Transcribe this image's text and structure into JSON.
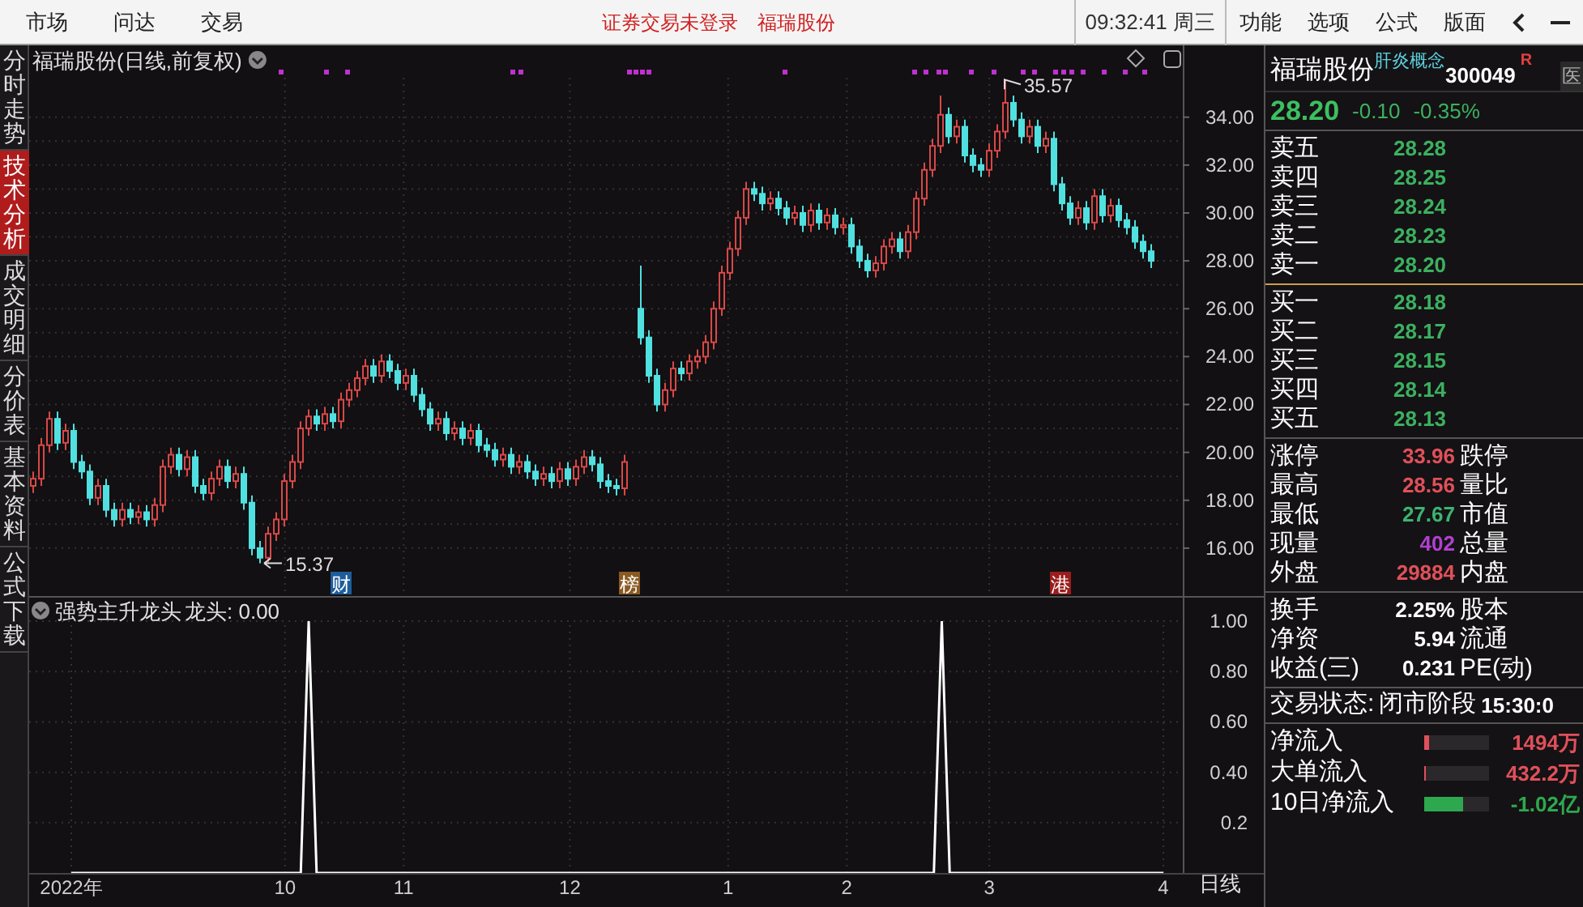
{
  "menu_bar": {
    "left_items": [
      "市场",
      "问达",
      "交易"
    ],
    "notice": "证券交易未登录",
    "stock": "福瑞股份",
    "clock": "09:32:41 周三",
    "right_items": [
      "功能",
      "选项",
      "公式",
      "版面"
    ]
  },
  "side_tabs": [
    {
      "label": "分时走势",
      "selected": false
    },
    {
      "label": "技术分析",
      "selected": true
    },
    {
      "label": "成交明细",
      "selected": false
    },
    {
      "label": "分价表",
      "selected": false
    },
    {
      "label": "基本资料",
      "selected": false
    },
    {
      "label": "公式下载",
      "selected": false
    }
  ],
  "main_chart": {
    "title": "福瑞股份(日线,前复权)",
    "high_label": "35.57",
    "low_label": "15.37",
    "event_marks": [
      {
        "label": "财",
        "color": "#1d5d9b"
      },
      {
        "label": "榜",
        "color": "#8a5a22"
      },
      {
        "label": "港",
        "color": "#9b1d1d"
      }
    ],
    "chart_data": {
      "type": "candlestick",
      "grid": true,
      "ylim": [
        14,
        37
      ],
      "yticks": [
        {
          "value": 34,
          "label": "34.00"
        },
        {
          "value": 32,
          "label": "32.00"
        },
        {
          "value": 30,
          "label": "30.00"
        },
        {
          "value": 28,
          "label": "28.00"
        },
        {
          "value": 26,
          "label": "26.00"
        },
        {
          "value": 24,
          "label": "24.00"
        },
        {
          "value": 22,
          "label": "22.00"
        },
        {
          "value": 20,
          "label": "20.00"
        },
        {
          "value": 18,
          "label": "18.00"
        },
        {
          "value": 16,
          "label": "16.00"
        }
      ],
      "ohlc": [
        [
          18.6,
          19.2,
          18.3,
          18.9
        ],
        [
          18.9,
          20.6,
          18.6,
          20.3
        ],
        [
          20.3,
          21.7,
          20.0,
          21.4
        ],
        [
          21.4,
          21.7,
          20.1,
          20.4
        ],
        [
          20.4,
          21.2,
          20.1,
          20.9
        ],
        [
          20.9,
          21.2,
          19.3,
          19.6
        ],
        [
          19.6,
          19.9,
          18.9,
          19.2
        ],
        [
          19.2,
          19.5,
          17.8,
          18.1
        ],
        [
          18.1,
          18.9,
          17.8,
          18.6
        ],
        [
          18.6,
          18.9,
          17.3,
          17.6
        ],
        [
          17.6,
          17.9,
          16.9,
          17.2
        ],
        [
          17.2,
          17.9,
          16.9,
          17.6
        ],
        [
          17.6,
          17.9,
          17.0,
          17.3
        ],
        [
          17.3,
          17.8,
          17.0,
          17.5
        ],
        [
          17.5,
          17.8,
          16.9,
          17.2
        ],
        [
          17.2,
          18.1,
          16.9,
          17.8
        ],
        [
          17.8,
          19.7,
          17.5,
          19.4
        ],
        [
          19.4,
          20.2,
          19.1,
          19.9
        ],
        [
          19.9,
          20.2,
          19.0,
          19.3
        ],
        [
          19.3,
          20.1,
          19.0,
          19.8
        ],
        [
          19.8,
          20.1,
          18.3,
          18.6
        ],
        [
          18.6,
          18.9,
          18.0,
          18.3
        ],
        [
          18.3,
          19.2,
          18.0,
          18.9
        ],
        [
          18.9,
          19.7,
          18.6,
          19.4
        ],
        [
          19.4,
          19.7,
          18.5,
          18.8
        ],
        [
          18.8,
          19.4,
          18.5,
          19.1
        ],
        [
          19.1,
          19.4,
          17.6,
          17.9
        ],
        [
          17.9,
          18.2,
          15.7,
          16.0
        ],
        [
          16.0,
          16.3,
          15.37,
          15.6
        ],
        [
          15.6,
          16.9,
          15.4,
          16.6
        ],
        [
          16.6,
          17.5,
          16.3,
          17.2
        ],
        [
          17.2,
          19.1,
          16.9,
          18.8
        ],
        [
          18.8,
          19.9,
          18.5,
          19.6
        ],
        [
          19.6,
          21.3,
          19.3,
          21.0
        ],
        [
          21.0,
          21.8,
          20.7,
          21.5
        ],
        [
          21.5,
          21.8,
          20.9,
          21.2
        ],
        [
          21.2,
          21.9,
          20.9,
          21.6
        ],
        [
          21.6,
          21.9,
          21.0,
          21.3
        ],
        [
          21.3,
          22.5,
          21.0,
          22.2
        ],
        [
          22.2,
          22.9,
          21.9,
          22.6
        ],
        [
          22.6,
          23.4,
          22.3,
          23.1
        ],
        [
          23.1,
          23.9,
          22.8,
          23.6
        ],
        [
          23.6,
          23.9,
          22.9,
          23.2
        ],
        [
          23.2,
          24.1,
          22.9,
          23.8
        ],
        [
          23.8,
          24.1,
          23.1,
          23.4
        ],
        [
          23.4,
          23.7,
          22.6,
          22.9
        ],
        [
          22.9,
          23.5,
          22.6,
          23.2
        ],
        [
          23.2,
          23.5,
          22.1,
          22.4
        ],
        [
          22.4,
          22.7,
          21.5,
          21.8
        ],
        [
          21.8,
          22.1,
          20.9,
          21.2
        ],
        [
          21.2,
          21.7,
          20.9,
          21.4
        ],
        [
          21.4,
          21.7,
          20.5,
          20.8
        ],
        [
          20.8,
          21.3,
          20.5,
          21.0
        ],
        [
          21.0,
          21.3,
          20.3,
          20.6
        ],
        [
          20.6,
          21.2,
          20.3,
          20.9
        ],
        [
          20.9,
          21.2,
          20.0,
          20.3
        ],
        [
          20.3,
          20.6,
          19.8,
          20.1
        ],
        [
          20.1,
          20.4,
          19.4,
          19.7
        ],
        [
          19.7,
          20.2,
          19.4,
          19.9
        ],
        [
          19.9,
          20.2,
          19.1,
          19.4
        ],
        [
          19.4,
          19.9,
          19.1,
          19.6
        ],
        [
          19.6,
          19.9,
          18.9,
          19.2
        ],
        [
          19.2,
          19.5,
          18.6,
          18.9
        ],
        [
          18.9,
          19.4,
          18.6,
          19.1
        ],
        [
          19.1,
          19.4,
          18.5,
          18.8
        ],
        [
          18.8,
          19.6,
          18.5,
          19.3
        ],
        [
          19.3,
          19.6,
          18.6,
          18.9
        ],
        [
          18.9,
          19.7,
          18.6,
          19.4
        ],
        [
          19.4,
          20.1,
          19.1,
          19.8
        ],
        [
          19.8,
          20.1,
          19.2,
          19.5
        ],
        [
          19.5,
          19.8,
          18.5,
          18.8
        ],
        [
          18.8,
          19.1,
          18.3,
          18.6
        ],
        [
          18.6,
          18.9,
          18.2,
          18.5
        ],
        [
          18.5,
          19.9,
          18.2,
          19.6
        ],
        null,
        [
          26.0,
          27.8,
          24.5,
          24.8
        ],
        [
          24.8,
          25.1,
          22.9,
          23.2
        ],
        [
          23.2,
          23.5,
          21.7,
          22.0
        ],
        [
          22.0,
          22.9,
          21.7,
          22.6
        ],
        [
          22.6,
          23.8,
          22.3,
          23.5
        ],
        [
          23.5,
          23.8,
          23.0,
          23.3
        ],
        [
          23.3,
          24.1,
          23.0,
          23.8
        ],
        [
          23.8,
          24.3,
          23.5,
          24.0
        ],
        [
          24.0,
          24.9,
          23.7,
          24.6
        ],
        [
          24.6,
          26.3,
          24.3,
          26.0
        ],
        [
          26.0,
          27.8,
          25.7,
          27.5
        ],
        [
          27.5,
          28.8,
          27.2,
          28.5
        ],
        [
          28.5,
          30.1,
          28.2,
          29.8
        ],
        [
          29.8,
          31.3,
          29.5,
          31.0
        ],
        [
          31.0,
          31.3,
          30.5,
          30.8
        ],
        [
          30.8,
          31.1,
          30.1,
          30.4
        ],
        [
          30.4,
          30.9,
          30.1,
          30.6
        ],
        [
          30.6,
          30.9,
          29.9,
          30.2
        ],
        [
          30.2,
          30.5,
          29.5,
          29.8
        ],
        [
          29.8,
          30.3,
          29.5,
          30.0
        ],
        [
          30.0,
          30.3,
          29.2,
          29.5
        ],
        [
          29.5,
          30.4,
          29.2,
          30.1
        ],
        [
          30.1,
          30.4,
          29.3,
          29.6
        ],
        [
          29.6,
          30.2,
          29.3,
          29.9
        ],
        [
          29.9,
          30.2,
          29.1,
          29.4
        ],
        [
          29.4,
          29.8,
          29.1,
          29.5
        ],
        [
          29.5,
          29.8,
          28.3,
          28.6
        ],
        [
          28.6,
          28.9,
          27.7,
          28.0
        ],
        [
          28.0,
          28.3,
          27.3,
          27.6
        ],
        [
          27.6,
          28.2,
          27.3,
          27.9
        ],
        [
          27.9,
          28.9,
          27.6,
          28.6
        ],
        [
          28.6,
          29.2,
          28.3,
          28.9
        ],
        [
          28.9,
          29.2,
          28.1,
          28.4
        ],
        [
          28.4,
          29.5,
          28.1,
          29.2
        ],
        [
          29.2,
          30.9,
          28.9,
          30.6
        ],
        [
          30.6,
          32.1,
          30.3,
          31.8
        ],
        [
          31.8,
          33.1,
          31.5,
          32.8
        ],
        [
          32.8,
          34.9,
          32.5,
          34.1
        ],
        [
          34.1,
          34.4,
          32.9,
          33.2
        ],
        [
          33.2,
          33.9,
          32.9,
          33.6
        ],
        [
          33.6,
          33.9,
          32.1,
          32.4
        ],
        [
          32.4,
          32.7,
          31.7,
          32.0
        ],
        [
          32.0,
          32.3,
          31.5,
          31.8
        ],
        [
          31.8,
          32.9,
          31.5,
          32.6
        ],
        [
          32.6,
          33.7,
          32.3,
          33.4
        ],
        [
          33.4,
          35.57,
          33.1,
          34.6
        ],
        [
          34.6,
          34.9,
          33.6,
          33.9
        ],
        [
          33.9,
          34.2,
          32.9,
          33.2
        ],
        [
          33.2,
          33.9,
          32.9,
          33.6
        ],
        [
          33.6,
          33.9,
          32.5,
          32.8
        ],
        [
          32.8,
          33.4,
          32.5,
          33.1
        ],
        [
          33.1,
          33.4,
          30.9,
          31.2
        ],
        [
          31.2,
          31.5,
          30.1,
          30.4
        ],
        [
          30.4,
          30.7,
          29.5,
          29.8
        ],
        [
          29.8,
          30.5,
          29.5,
          30.2
        ],
        [
          30.2,
          30.5,
          29.3,
          29.6
        ],
        [
          29.6,
          31.0,
          29.3,
          30.7
        ],
        [
          30.7,
          31.0,
          29.6,
          29.9
        ],
        [
          29.9,
          30.6,
          29.6,
          30.3
        ],
        [
          30.3,
          30.6,
          29.4,
          29.7
        ],
        [
          29.7,
          30.0,
          29.1,
          29.4
        ],
        [
          29.4,
          29.7,
          28.5,
          28.8
        ],
        [
          28.8,
          29.1,
          28.1,
          28.4
        ],
        [
          28.4,
          28.7,
          27.7,
          28.0
        ]
      ]
    }
  },
  "indicator_pane": {
    "title": "强势主升龙头",
    "reading": "龙头: 0.00",
    "chart_data": {
      "type": "line",
      "grid": true,
      "ylim": [
        0,
        1.1
      ],
      "yticks": [
        {
          "value": 1,
          "label": "1.00"
        },
        {
          "value": 0.8,
          "label": "0.80"
        },
        {
          "value": 0.6,
          "label": "0.60"
        },
        {
          "value": 0.4,
          "label": "0.40"
        },
        {
          "value": 0.2,
          "label": "0.2"
        }
      ],
      "categories": [
        "2022年",
        null,
        null,
        null,
        null,
        null,
        null,
        null,
        null,
        null,
        null,
        null,
        null,
        null,
        null,
        null,
        null,
        null,
        null,
        null,
        null,
        null,
        null,
        null,
        null,
        null,
        null,
        "10",
        null,
        null,
        null,
        null,
        null,
        null,
        null,
        null,
        null,
        null,
        null,
        null,
        null,
        null,
        "11",
        null,
        null,
        null,
        null,
        null,
        null,
        null,
        null,
        null,
        null,
        null,
        null,
        null,
        null,
        null,
        null,
        null,
        null,
        null,
        null,
        "12",
        null,
        null,
        null,
        null,
        null,
        null,
        null,
        null,
        null,
        null,
        null,
        null,
        null,
        null,
        null,
        null,
        null,
        null,
        null,
        "1",
        null,
        null,
        null,
        null,
        null,
        null,
        null,
        null,
        null,
        null,
        null,
        null,
        null,
        null,
        "2",
        null,
        null,
        null,
        null,
        null,
        null,
        null,
        null,
        null,
        null,
        null,
        null,
        null,
        null,
        null,
        null,
        null,
        "3",
        null,
        null,
        null,
        null,
        null,
        null,
        null,
        null,
        null,
        null,
        null,
        null,
        null,
        null,
        null,
        null,
        null,
        null,
        null,
        null,
        null,
        "4"
      ],
      "series": [
        {
          "color": "#ffffff",
          "values": [
            0,
            0,
            0,
            0,
            0,
            0,
            0,
            0,
            0,
            0,
            0,
            0,
            0,
            0,
            0,
            0,
            0,
            0,
            0,
            0,
            0,
            0,
            0,
            0,
            0,
            0,
            0,
            0,
            0,
            0,
            1,
            0,
            0,
            0,
            0,
            0,
            0,
            0,
            0,
            0,
            0,
            0,
            0,
            0,
            0,
            0,
            0,
            0,
            0,
            0,
            0,
            0,
            0,
            0,
            0,
            0,
            0,
            0,
            0,
            0,
            0,
            0,
            0,
            0,
            0,
            0,
            0,
            0,
            0,
            0,
            0,
            0,
            0,
            0,
            0,
            0,
            0,
            0,
            0,
            0,
            0,
            0,
            0,
            0,
            0,
            0,
            0,
            0,
            0,
            0,
            0,
            0,
            0,
            0,
            0,
            0,
            0,
            0,
            0,
            0,
            0,
            0,
            0,
            0,
            0,
            0,
            0,
            0,
            0,
            0,
            1,
            0,
            0,
            0,
            0,
            0,
            0,
            0,
            0,
            0,
            0,
            0,
            0,
            0,
            0,
            0,
            0,
            0,
            0,
            0,
            0,
            0,
            0,
            0,
            0,
            0,
            0,
            0,
            0
          ]
        }
      ]
    }
  },
  "period_label": "日线",
  "quote": {
    "name": "福瑞股份",
    "concept": "肝炎概念",
    "code": "300049",
    "flag": "R",
    "side_tab": "医",
    "price": "28.20",
    "change": "-0.10",
    "change_pct": "-0.35%",
    "asks": [
      {
        "label": "卖五",
        "price": "28.28"
      },
      {
        "label": "卖四",
        "price": "28.25"
      },
      {
        "label": "卖三",
        "price": "28.24"
      },
      {
        "label": "卖二",
        "price": "28.23"
      },
      {
        "label": "卖一",
        "price": "28.20"
      }
    ],
    "bids": [
      {
        "label": "买一",
        "price": "28.18"
      },
      {
        "label": "买二",
        "price": "28.17"
      },
      {
        "label": "买三",
        "price": "28.15"
      },
      {
        "label": "买四",
        "price": "28.14"
      },
      {
        "label": "买五",
        "price": "28.13"
      }
    ],
    "stats": [
      {
        "label": "涨停",
        "value": "33.96",
        "color": "#e0505a",
        "label2": "跌停"
      },
      {
        "label": "最高",
        "value": "28.56",
        "color": "#e0505a",
        "label2": "量比"
      },
      {
        "label": "最低",
        "value": "27.67",
        "color": "#3cb371",
        "label2": "市值"
      },
      {
        "label": "现量",
        "value": "402",
        "color": "#b040d0",
        "label2": "总量"
      },
      {
        "label": "外盘",
        "value": "29884",
        "color": "#e0505a",
        "label2": "内盘"
      }
    ],
    "finance": [
      {
        "label": "换手",
        "value": "2.25%",
        "label2": "股本"
      },
      {
        "label": "净资",
        "value": "5.94",
        "label2": "流通"
      },
      {
        "label": "收益(三)",
        "value": "0.231",
        "label2": "PE(动)"
      }
    ],
    "status_label": "交易状态:",
    "status_value": "闭市阶段",
    "status_time": "15:30:0",
    "flows": [
      {
        "label": "净流入",
        "level": 0.08,
        "color": "#e0505a",
        "value": "1494万"
      },
      {
        "label": "大单流入",
        "level": 0.02,
        "color": "#e0505a",
        "value": "432.2万"
      },
      {
        "label": "10日净流入",
        "level": 0.6,
        "color": "#2ea84f",
        "value": "-1.02亿"
      }
    ]
  }
}
